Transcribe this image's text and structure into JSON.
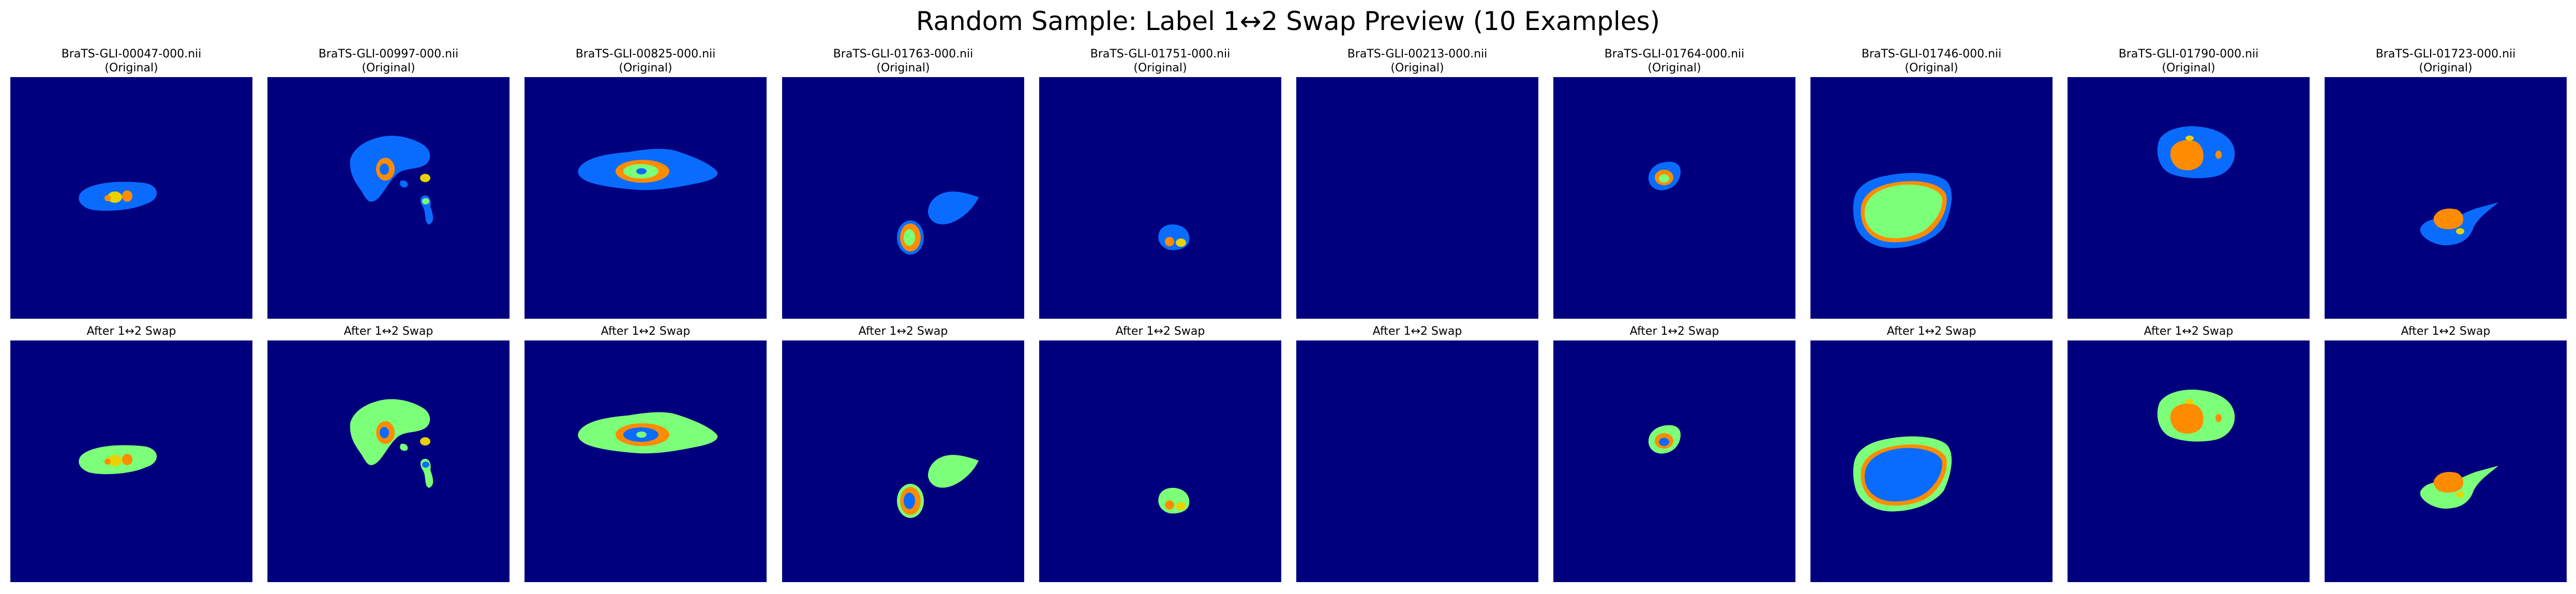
{
  "figure_title": "Random Sample: Label 1↔2 Swap Preview (10 Examples)",
  "colors": {
    "background": "#00007f",
    "label_blue": "#0a6cff",
    "label_green": "#7cff79",
    "label_orange": "#ff8c00",
    "label_yellow": "#e8d300"
  },
  "panels": [
    {
      "file": "BraTS-GLI-00047-000.nii",
      "original_caption": "(Original)",
      "swap_caption": "After 1↔2 Swap"
    },
    {
      "file": "BraTS-GLI-00997-000.nii",
      "original_caption": "(Original)",
      "swap_caption": "After 1↔2 Swap"
    },
    {
      "file": "BraTS-GLI-00825-000.nii",
      "original_caption": "(Original)",
      "swap_caption": "After 1↔2 Swap"
    },
    {
      "file": "BraTS-GLI-01763-000.nii",
      "original_caption": "(Original)",
      "swap_caption": "After 1↔2 Swap"
    },
    {
      "file": "BraTS-GLI-01751-000.nii",
      "original_caption": "(Original)",
      "swap_caption": "After 1↔2 Swap"
    },
    {
      "file": "BraTS-GLI-00213-000.nii",
      "original_caption": "(Original)",
      "swap_caption": "After 1↔2 Swap"
    },
    {
      "file": "BraTS-GLI-01764-000.nii",
      "original_caption": "(Original)",
      "swap_caption": "After 1↔2 Swap"
    },
    {
      "file": "BraTS-GLI-01746-000.nii",
      "original_caption": "(Original)",
      "swap_caption": "After 1↔2 Swap"
    },
    {
      "file": "BraTS-GLI-01790-000.nii",
      "original_caption": "(Original)",
      "swap_caption": "After 1↔2 Swap"
    },
    {
      "file": "BraTS-GLI-01723-000.nii",
      "original_caption": "(Original)",
      "swap_caption": "After 1↔2 Swap"
    }
  ]
}
